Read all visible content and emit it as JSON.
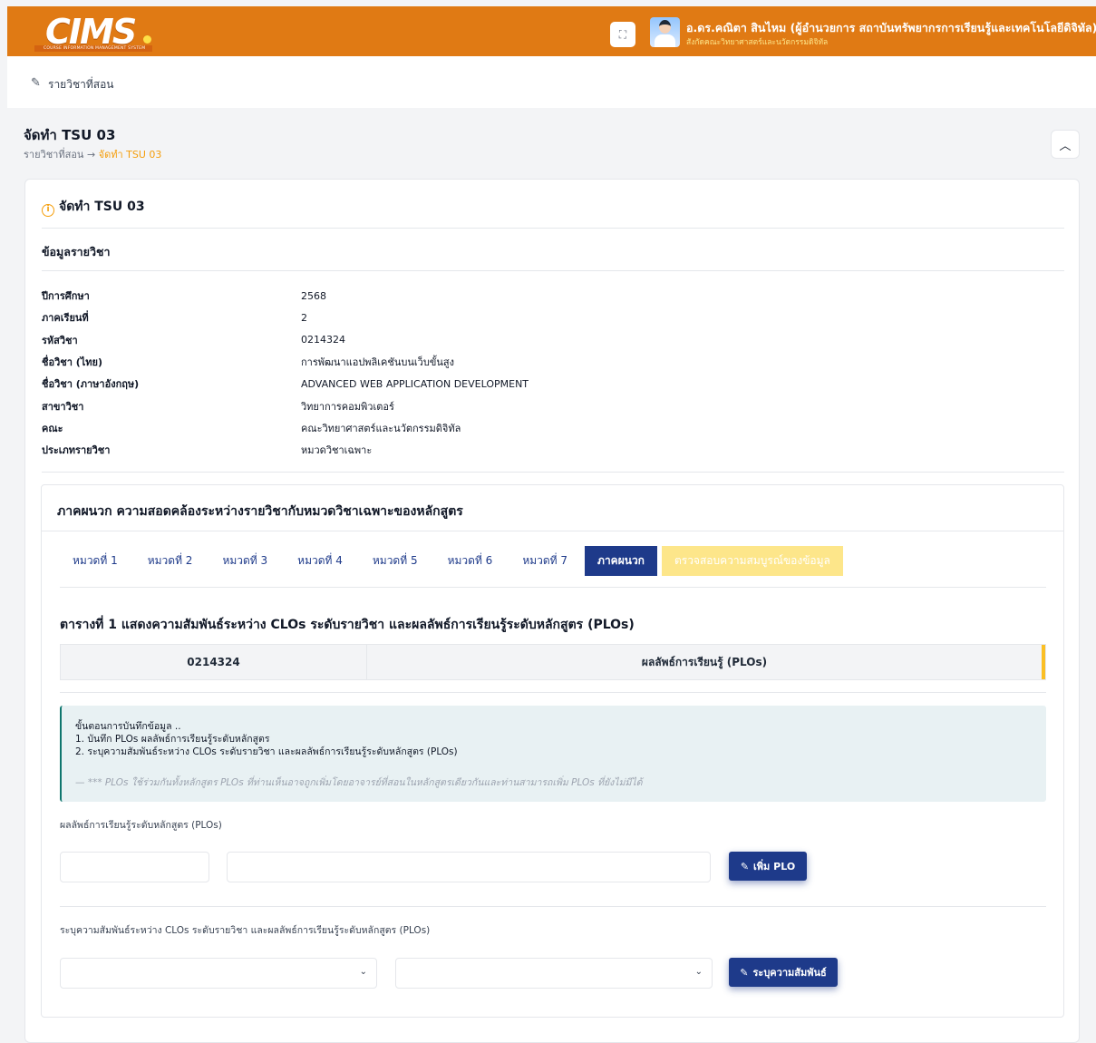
{
  "brand": {
    "logo_text": "CIMS",
    "logo_subtitle": "COURSE INFORMATION MANAGEMENT SYSTEM",
    "accent": "#e07a14",
    "primary": "#1e3a8a"
  },
  "header": {
    "fullscreen_icon": "fullscreen-icon",
    "user_name": "อ.ดร.คณิตา สินไหม (ผู้อำนวยการ สถาบันทรัพยากรการเรียนรู้และเทคโนโลยีดิจิทัล)",
    "user_dept": "สังกัดคณะวิทยาศาสตร์และนวัตกรรมดิจิทัล"
  },
  "subbar": {
    "label": "รายวิชาที่สอน"
  },
  "page": {
    "title": "จัดทำ TSU 03",
    "breadcrumb_root": "รายวิชาที่สอน",
    "breadcrumb_sep": "→",
    "breadcrumb_current": "จัดทำ TSU 03"
  },
  "card": {
    "title": "จัดทำ TSU 03",
    "section_title": "ข้อมูลรายวิชา",
    "info": [
      {
        "label": "ปีการศึกษา",
        "value": "2568"
      },
      {
        "label": "ภาคเรียนที่",
        "value": "2"
      },
      {
        "label": "รหัสวิชา",
        "value": "0214324"
      },
      {
        "label": "ชื่อวิชา (ไทย)",
        "value": "การพัฒนาแอปพลิเคชันบนเว็บขั้นสูง"
      },
      {
        "label": "ชื่อวิชา (ภาษาอังกฤษ)",
        "value": "ADVANCED WEB APPLICATION DEVELOPMENT"
      },
      {
        "label": "สาขาวิชา",
        "value": "วิทยาการคอมพิวเตอร์"
      },
      {
        "label": "คณะ",
        "value": "คณะวิทยาศาสตร์และนวัตกรรมดิจิทัล"
      },
      {
        "label": "ประเภทรายวิชา",
        "value": "หมวดวิชาเฉพาะ"
      }
    ]
  },
  "appendix": {
    "title": "ภาคผนวก ความสอดคล้องระหว่างรายวิชากับหมวดวิชาเฉพาะของหลักสูตร",
    "tabs": [
      "หมวดที่ 1",
      "หมวดที่ 2",
      "หมวดที่ 3",
      "หมวดที่ 4",
      "หมวดที่ 5",
      "หมวดที่ 6",
      "หมวดที่ 7",
      "ภาคผนวก",
      "ตรวจสอบความสมบูรณ์ของข้อมูล"
    ],
    "active_tab": "ภาคผนวก",
    "table_title": "ตารางที่ 1 แสดงความสัมพันธ์ระหว่าง CLOs ระดับรายวิชา และผลลัพธ์การเรียนรู้ระดับหลักสูตร (PLOs)",
    "table_col1": "0214324",
    "table_col2": "ผลลัพธ์การเรียนรู้ (PLOs)",
    "steps_title": "ขั้นตอนการบันทึกข้อมูล ..",
    "step1": "1. บันทึก PLOs ผลลัพธ์การเรียนรู้ระดับหลักสูตร",
    "step2": "2. ระบุความสัมพันธ์ระหว่าง CLOs ระดับรายวิชา และผลลัพธ์การเรียนรู้ระดับหลักสูตร (PLOs)",
    "note": "— *** PLOs ใช้ร่วมกันทั้งหลักสูตร PLOs ที่ท่านเห็นอาจถูกเพิ่มโดยอาจารย์ที่สอนในหลักสูตรเดียวกันและท่านสามารถเพิ่ม PLOs ที่ยังไม่มีได้",
    "plo_label": "ผลลัพธ์การเรียนรู้ระดับหลักสูตร (PLOs)",
    "plo_code_value": "",
    "plo_desc_value": "",
    "add_plo_button": "เพิ่ม PLO",
    "relation_label": "ระบุความสัมพันธ์ระหว่าง CLOs ระดับรายวิชา และผลลัพธ์การเรียนรู้ระดับหลักสูตร (PLOs)",
    "clo_select_value": "",
    "plo_select_value": "",
    "relation_button": "ระบุความสัมพันธ์"
  }
}
